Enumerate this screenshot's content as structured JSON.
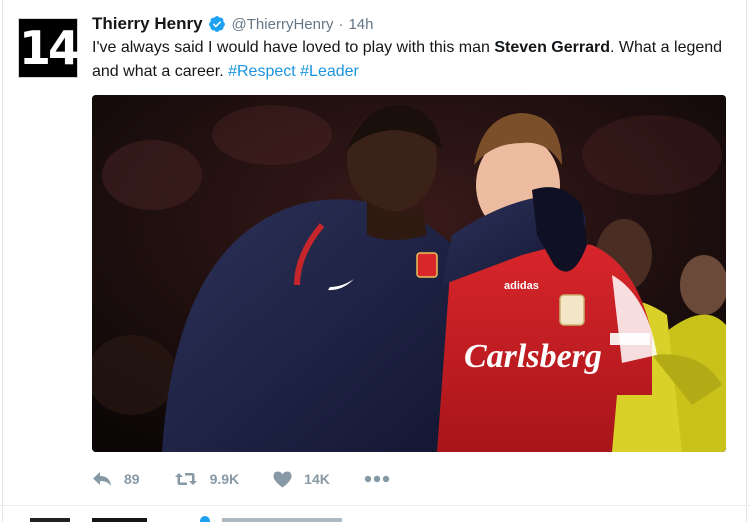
{
  "tweet": {
    "avatar_text": "14",
    "fullname": "Thierry Henry",
    "username": "@ThierryHenry",
    "separator": "·",
    "time": "14h",
    "text_before": "I've always said I would have loved to play with this man ",
    "text_bold": "Steven Gerrard",
    "text_after": ". What a legend and what a career. ",
    "hashtag_1": "#Respect",
    "hashtag_2": "#Leader",
    "media": {
      "jersey_sponsor": "Carlsberg",
      "kit_brand": "adidas"
    },
    "actions": {
      "reply_count": "89",
      "retweet_count": "9.9K",
      "like_count": "14K",
      "more_icon": "more-dots-icon"
    },
    "colors": {
      "link": "#1b95e0",
      "verified": "#1da1f2",
      "muted": "#657786",
      "action_icon": "#8899a6"
    }
  }
}
